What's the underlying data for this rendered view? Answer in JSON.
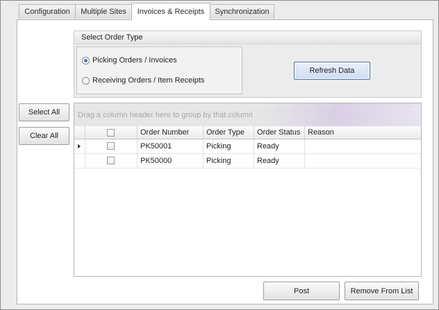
{
  "tabs": [
    {
      "label": "Configuration"
    },
    {
      "label": "Multiple Sites"
    },
    {
      "label": "Invoices & Receipts"
    },
    {
      "label": "Synchronization"
    }
  ],
  "order_type": {
    "title": "Select Order Type",
    "options": [
      {
        "label": "Picking Orders / Invoices",
        "selected": true
      },
      {
        "label": "Receiving Orders / Item Receipts",
        "selected": false
      }
    ],
    "refresh_label": "Refresh Data"
  },
  "side_buttons": {
    "select_all": "Select All",
    "clear_all": "Clear All"
  },
  "grid": {
    "group_hint": "Drag a column header here to group by that column",
    "columns": [
      "Order Number",
      "Order Type",
      "Order Status",
      "Reason"
    ],
    "rows": [
      {
        "checked": false,
        "order_number": "PK50001",
        "order_type": "Picking",
        "order_status": "Ready",
        "reason": "",
        "current": true
      },
      {
        "checked": false,
        "order_number": "PK50000",
        "order_type": "Picking",
        "order_status": "Ready",
        "reason": "",
        "current": false
      }
    ]
  },
  "footer": {
    "post": "Post",
    "remove": "Remove From List"
  }
}
